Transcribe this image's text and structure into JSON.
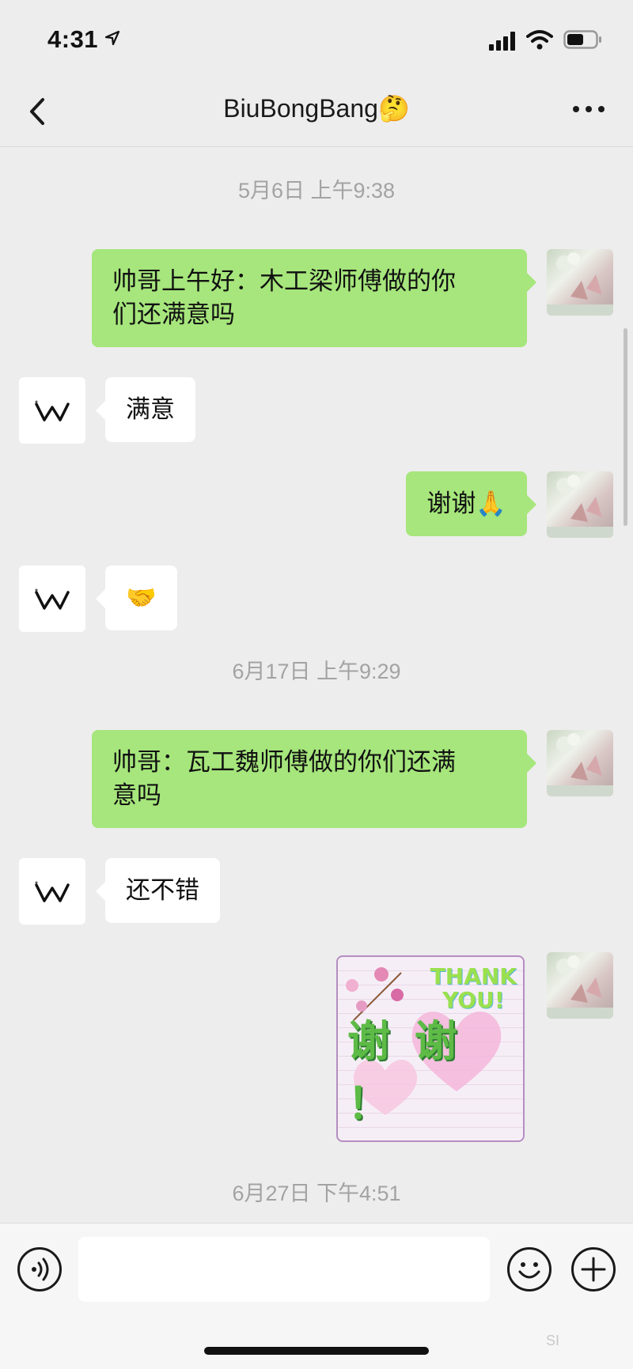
{
  "status": {
    "time": "4:31"
  },
  "nav": {
    "title": "BiuBongBang🤔"
  },
  "chat": {
    "timestamps": [
      "5月6日 上午9:38",
      "6月17日 上午9:29",
      "6月27日 下午4:51"
    ],
    "messages": [
      {
        "side": "me",
        "text": "帅哥上午好：木工梁师傅做的你\n们还满意吗"
      },
      {
        "side": "other",
        "text": "满意"
      },
      {
        "side": "me",
        "text": "谢谢🙏"
      },
      {
        "side": "other",
        "text": "🤝"
      },
      {
        "side": "me",
        "text": "帅哥：瓦工魏师傅做的你们还满\n意吗"
      },
      {
        "side": "other",
        "text": "还不错"
      }
    ],
    "sticker": {
      "line1": "THANK",
      "line2": "YOU!",
      "caption": "谢 谢 ！"
    }
  },
  "watermark": "SI"
}
